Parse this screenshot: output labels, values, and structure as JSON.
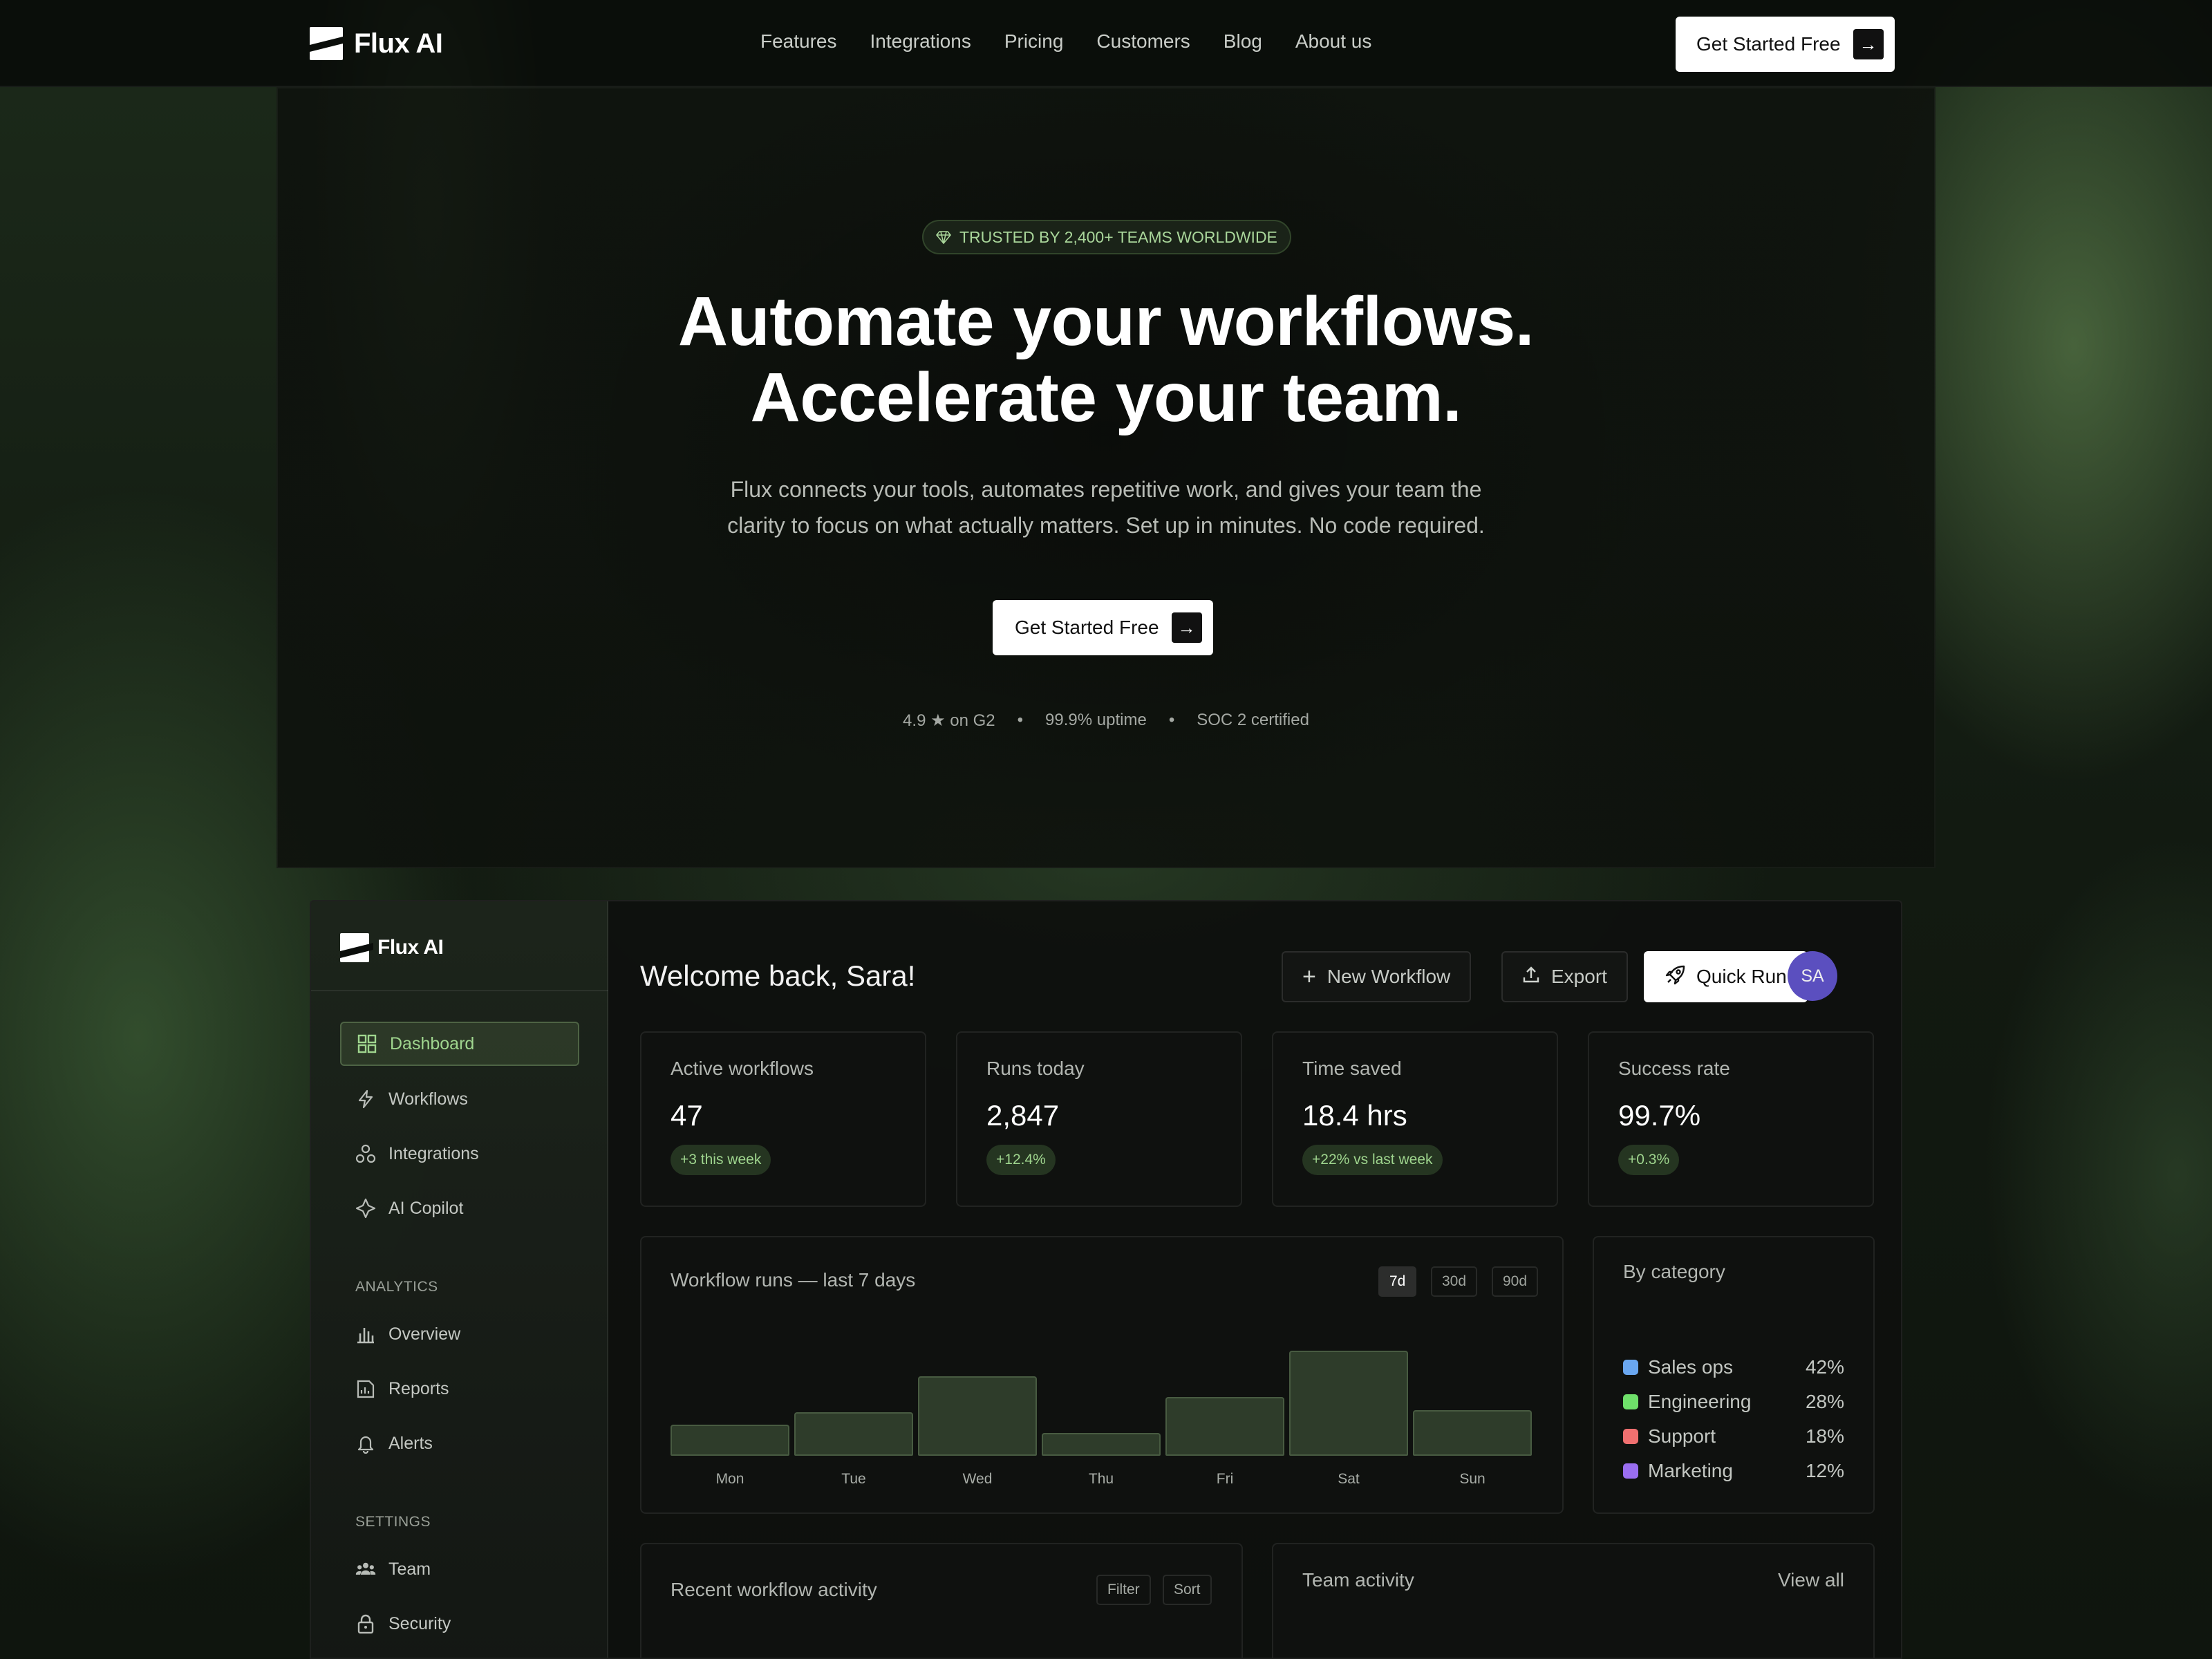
{
  "nav": {
    "brand": "Flux AI",
    "links": [
      "Features",
      "Integrations",
      "Pricing",
      "Customers",
      "Blog",
      "About us"
    ],
    "cta": "Get Started Free"
  },
  "hero": {
    "badge": "TRUSTED BY 2,400+ TEAMS WORLDWIDE",
    "title_line1": "Automate your workflows.",
    "title_line2": "Accelerate your team.",
    "subtitle_line1": "Flux connects your tools, automates repetitive work, and gives your team the",
    "subtitle_line2": "clarity to focus on what actually matters. Set up in minutes. No code required.",
    "cta": "Get Started Free",
    "meta": [
      "4.9 ★ on G2",
      "•",
      "99.9% uptime",
      "•",
      "SOC 2 certified"
    ]
  },
  "dashboard": {
    "brand": "Flux AI",
    "sidebar": {
      "main_items": [
        {
          "label": "Dashboard",
          "icon": "grid-icon"
        },
        {
          "label": "Workflows",
          "icon": "bolt-icon"
        },
        {
          "label": "Integrations",
          "icon": "integrations-icon"
        },
        {
          "label": "AI Copilot",
          "icon": "sparkle-icon"
        }
      ],
      "analytics_heading": "ANALYTICS",
      "analytics_items": [
        {
          "label": "Overview",
          "icon": "bar-chart-icon"
        },
        {
          "label": "Reports",
          "icon": "report-icon"
        },
        {
          "label": "Alerts",
          "icon": "bell-icon"
        }
      ],
      "settings_heading": "SETTINGS",
      "settings_items": [
        {
          "label": "Team",
          "icon": "team-icon"
        },
        {
          "label": "Security",
          "icon": "lock-icon"
        }
      ]
    },
    "welcome": "Welcome back, Sara!",
    "actions": {
      "new_workflow": "New Workflow",
      "export": "Export",
      "quick_run": "Quick Run",
      "avatar": "SA"
    },
    "kpis": [
      {
        "label": "Active workflows",
        "value": "47",
        "delta": "+3 this week"
      },
      {
        "label": "Runs today",
        "value": "2,847",
        "delta": "+12.4%"
      },
      {
        "label": "Time saved",
        "value": "18.4 hrs",
        "delta": "+22% vs last week"
      },
      {
        "label": "Success rate",
        "value": "99.7%",
        "delta": "+0.3%"
      }
    ],
    "runs_card": {
      "title": "Workflow runs — last 7 days",
      "ranges": [
        "7d",
        "30d",
        "90d"
      ],
      "selected_range": "7d"
    },
    "category_card": {
      "title": "By category",
      "items": [
        {
          "label": "Sales ops",
          "pct": "42%",
          "color": "#6aa7f0"
        },
        {
          "label": "Engineering",
          "pct": "28%",
          "color": "#6fe06a"
        },
        {
          "label": "Support",
          "pct": "18%",
          "color": "#f07070"
        },
        {
          "label": "Marketing",
          "pct": "12%",
          "color": "#9a6ef0"
        }
      ]
    },
    "recent_card": {
      "title": "Recent workflow activity",
      "filter": "Filter",
      "sort": "Sort"
    },
    "team_card": {
      "title": "Team activity",
      "view_all": "View all"
    }
  },
  "chart_data": {
    "type": "bar",
    "title": "Workflow runs — last 7 days",
    "categories": [
      "Mon",
      "Tue",
      "Wed",
      "Thu",
      "Fri",
      "Sat",
      "Sun"
    ],
    "values": [
      45,
      63,
      115,
      33,
      85,
      152,
      66
    ],
    "xlabel": "",
    "ylabel": "",
    "ylim": [
      0,
      160
    ],
    "grid": false
  }
}
